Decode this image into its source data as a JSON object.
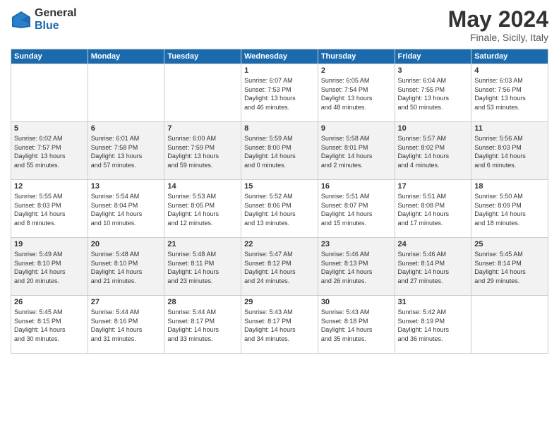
{
  "header": {
    "logo_general": "General",
    "logo_blue": "Blue",
    "title": "May 2024",
    "subtitle": "Finale, Sicily, Italy"
  },
  "weekdays": [
    "Sunday",
    "Monday",
    "Tuesday",
    "Wednesday",
    "Thursday",
    "Friday",
    "Saturday"
  ],
  "rows": [
    [
      {
        "num": "",
        "info": ""
      },
      {
        "num": "",
        "info": ""
      },
      {
        "num": "",
        "info": ""
      },
      {
        "num": "1",
        "info": "Sunrise: 6:07 AM\nSunset: 7:53 PM\nDaylight: 13 hours\nand 46 minutes."
      },
      {
        "num": "2",
        "info": "Sunrise: 6:05 AM\nSunset: 7:54 PM\nDaylight: 13 hours\nand 48 minutes."
      },
      {
        "num": "3",
        "info": "Sunrise: 6:04 AM\nSunset: 7:55 PM\nDaylight: 13 hours\nand 50 minutes."
      },
      {
        "num": "4",
        "info": "Sunrise: 6:03 AM\nSunset: 7:56 PM\nDaylight: 13 hours\nand 53 minutes."
      }
    ],
    [
      {
        "num": "5",
        "info": "Sunrise: 6:02 AM\nSunset: 7:57 PM\nDaylight: 13 hours\nand 55 minutes."
      },
      {
        "num": "6",
        "info": "Sunrise: 6:01 AM\nSunset: 7:58 PM\nDaylight: 13 hours\nand 57 minutes."
      },
      {
        "num": "7",
        "info": "Sunrise: 6:00 AM\nSunset: 7:59 PM\nDaylight: 13 hours\nand 59 minutes."
      },
      {
        "num": "8",
        "info": "Sunrise: 5:59 AM\nSunset: 8:00 PM\nDaylight: 14 hours\nand 0 minutes."
      },
      {
        "num": "9",
        "info": "Sunrise: 5:58 AM\nSunset: 8:01 PM\nDaylight: 14 hours\nand 2 minutes."
      },
      {
        "num": "10",
        "info": "Sunrise: 5:57 AM\nSunset: 8:02 PM\nDaylight: 14 hours\nand 4 minutes."
      },
      {
        "num": "11",
        "info": "Sunrise: 5:56 AM\nSunset: 8:03 PM\nDaylight: 14 hours\nand 6 minutes."
      }
    ],
    [
      {
        "num": "12",
        "info": "Sunrise: 5:55 AM\nSunset: 8:03 PM\nDaylight: 14 hours\nand 8 minutes."
      },
      {
        "num": "13",
        "info": "Sunrise: 5:54 AM\nSunset: 8:04 PM\nDaylight: 14 hours\nand 10 minutes."
      },
      {
        "num": "14",
        "info": "Sunrise: 5:53 AM\nSunset: 8:05 PM\nDaylight: 14 hours\nand 12 minutes."
      },
      {
        "num": "15",
        "info": "Sunrise: 5:52 AM\nSunset: 8:06 PM\nDaylight: 14 hours\nand 13 minutes."
      },
      {
        "num": "16",
        "info": "Sunrise: 5:51 AM\nSunset: 8:07 PM\nDaylight: 14 hours\nand 15 minutes."
      },
      {
        "num": "17",
        "info": "Sunrise: 5:51 AM\nSunset: 8:08 PM\nDaylight: 14 hours\nand 17 minutes."
      },
      {
        "num": "18",
        "info": "Sunrise: 5:50 AM\nSunset: 8:09 PM\nDaylight: 14 hours\nand 18 minutes."
      }
    ],
    [
      {
        "num": "19",
        "info": "Sunrise: 5:49 AM\nSunset: 8:10 PM\nDaylight: 14 hours\nand 20 minutes."
      },
      {
        "num": "20",
        "info": "Sunrise: 5:48 AM\nSunset: 8:10 PM\nDaylight: 14 hours\nand 21 minutes."
      },
      {
        "num": "21",
        "info": "Sunrise: 5:48 AM\nSunset: 8:11 PM\nDaylight: 14 hours\nand 23 minutes."
      },
      {
        "num": "22",
        "info": "Sunrise: 5:47 AM\nSunset: 8:12 PM\nDaylight: 14 hours\nand 24 minutes."
      },
      {
        "num": "23",
        "info": "Sunrise: 5:46 AM\nSunset: 8:13 PM\nDaylight: 14 hours\nand 26 minutes."
      },
      {
        "num": "24",
        "info": "Sunrise: 5:46 AM\nSunset: 8:14 PM\nDaylight: 14 hours\nand 27 minutes."
      },
      {
        "num": "25",
        "info": "Sunrise: 5:45 AM\nSunset: 8:14 PM\nDaylight: 14 hours\nand 29 minutes."
      }
    ],
    [
      {
        "num": "26",
        "info": "Sunrise: 5:45 AM\nSunset: 8:15 PM\nDaylight: 14 hours\nand 30 minutes."
      },
      {
        "num": "27",
        "info": "Sunrise: 5:44 AM\nSunset: 8:16 PM\nDaylight: 14 hours\nand 31 minutes."
      },
      {
        "num": "28",
        "info": "Sunrise: 5:44 AM\nSunset: 8:17 PM\nDaylight: 14 hours\nand 33 minutes."
      },
      {
        "num": "29",
        "info": "Sunrise: 5:43 AM\nSunset: 8:17 PM\nDaylight: 14 hours\nand 34 minutes."
      },
      {
        "num": "30",
        "info": "Sunrise: 5:43 AM\nSunset: 8:18 PM\nDaylight: 14 hours\nand 35 minutes."
      },
      {
        "num": "31",
        "info": "Sunrise: 5:42 AM\nSunset: 8:19 PM\nDaylight: 14 hours\nand 36 minutes."
      },
      {
        "num": "",
        "info": ""
      }
    ]
  ]
}
